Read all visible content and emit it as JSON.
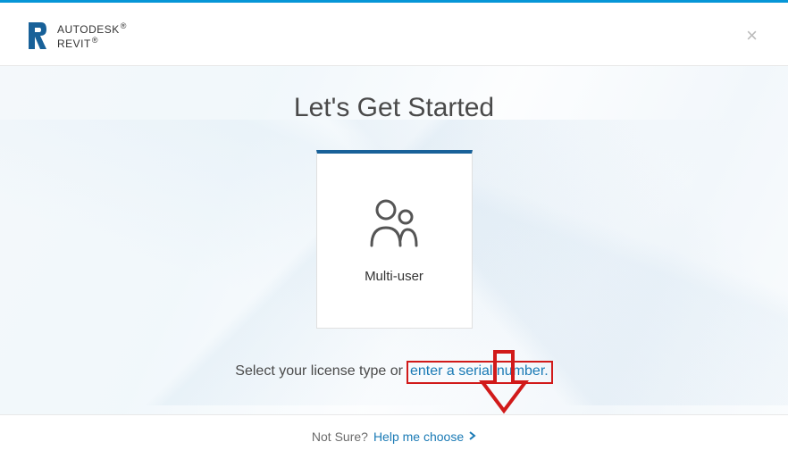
{
  "brand": {
    "line1": "AUTODESK",
    "line2": "REVIT"
  },
  "page_title": "Let's Get Started",
  "card": {
    "title": "Multi-user"
  },
  "prompt": {
    "prefix": "Select your license type or ",
    "link": "enter a serial number."
  },
  "footer": {
    "text": "Not Sure?",
    "link": "Help me choose"
  }
}
